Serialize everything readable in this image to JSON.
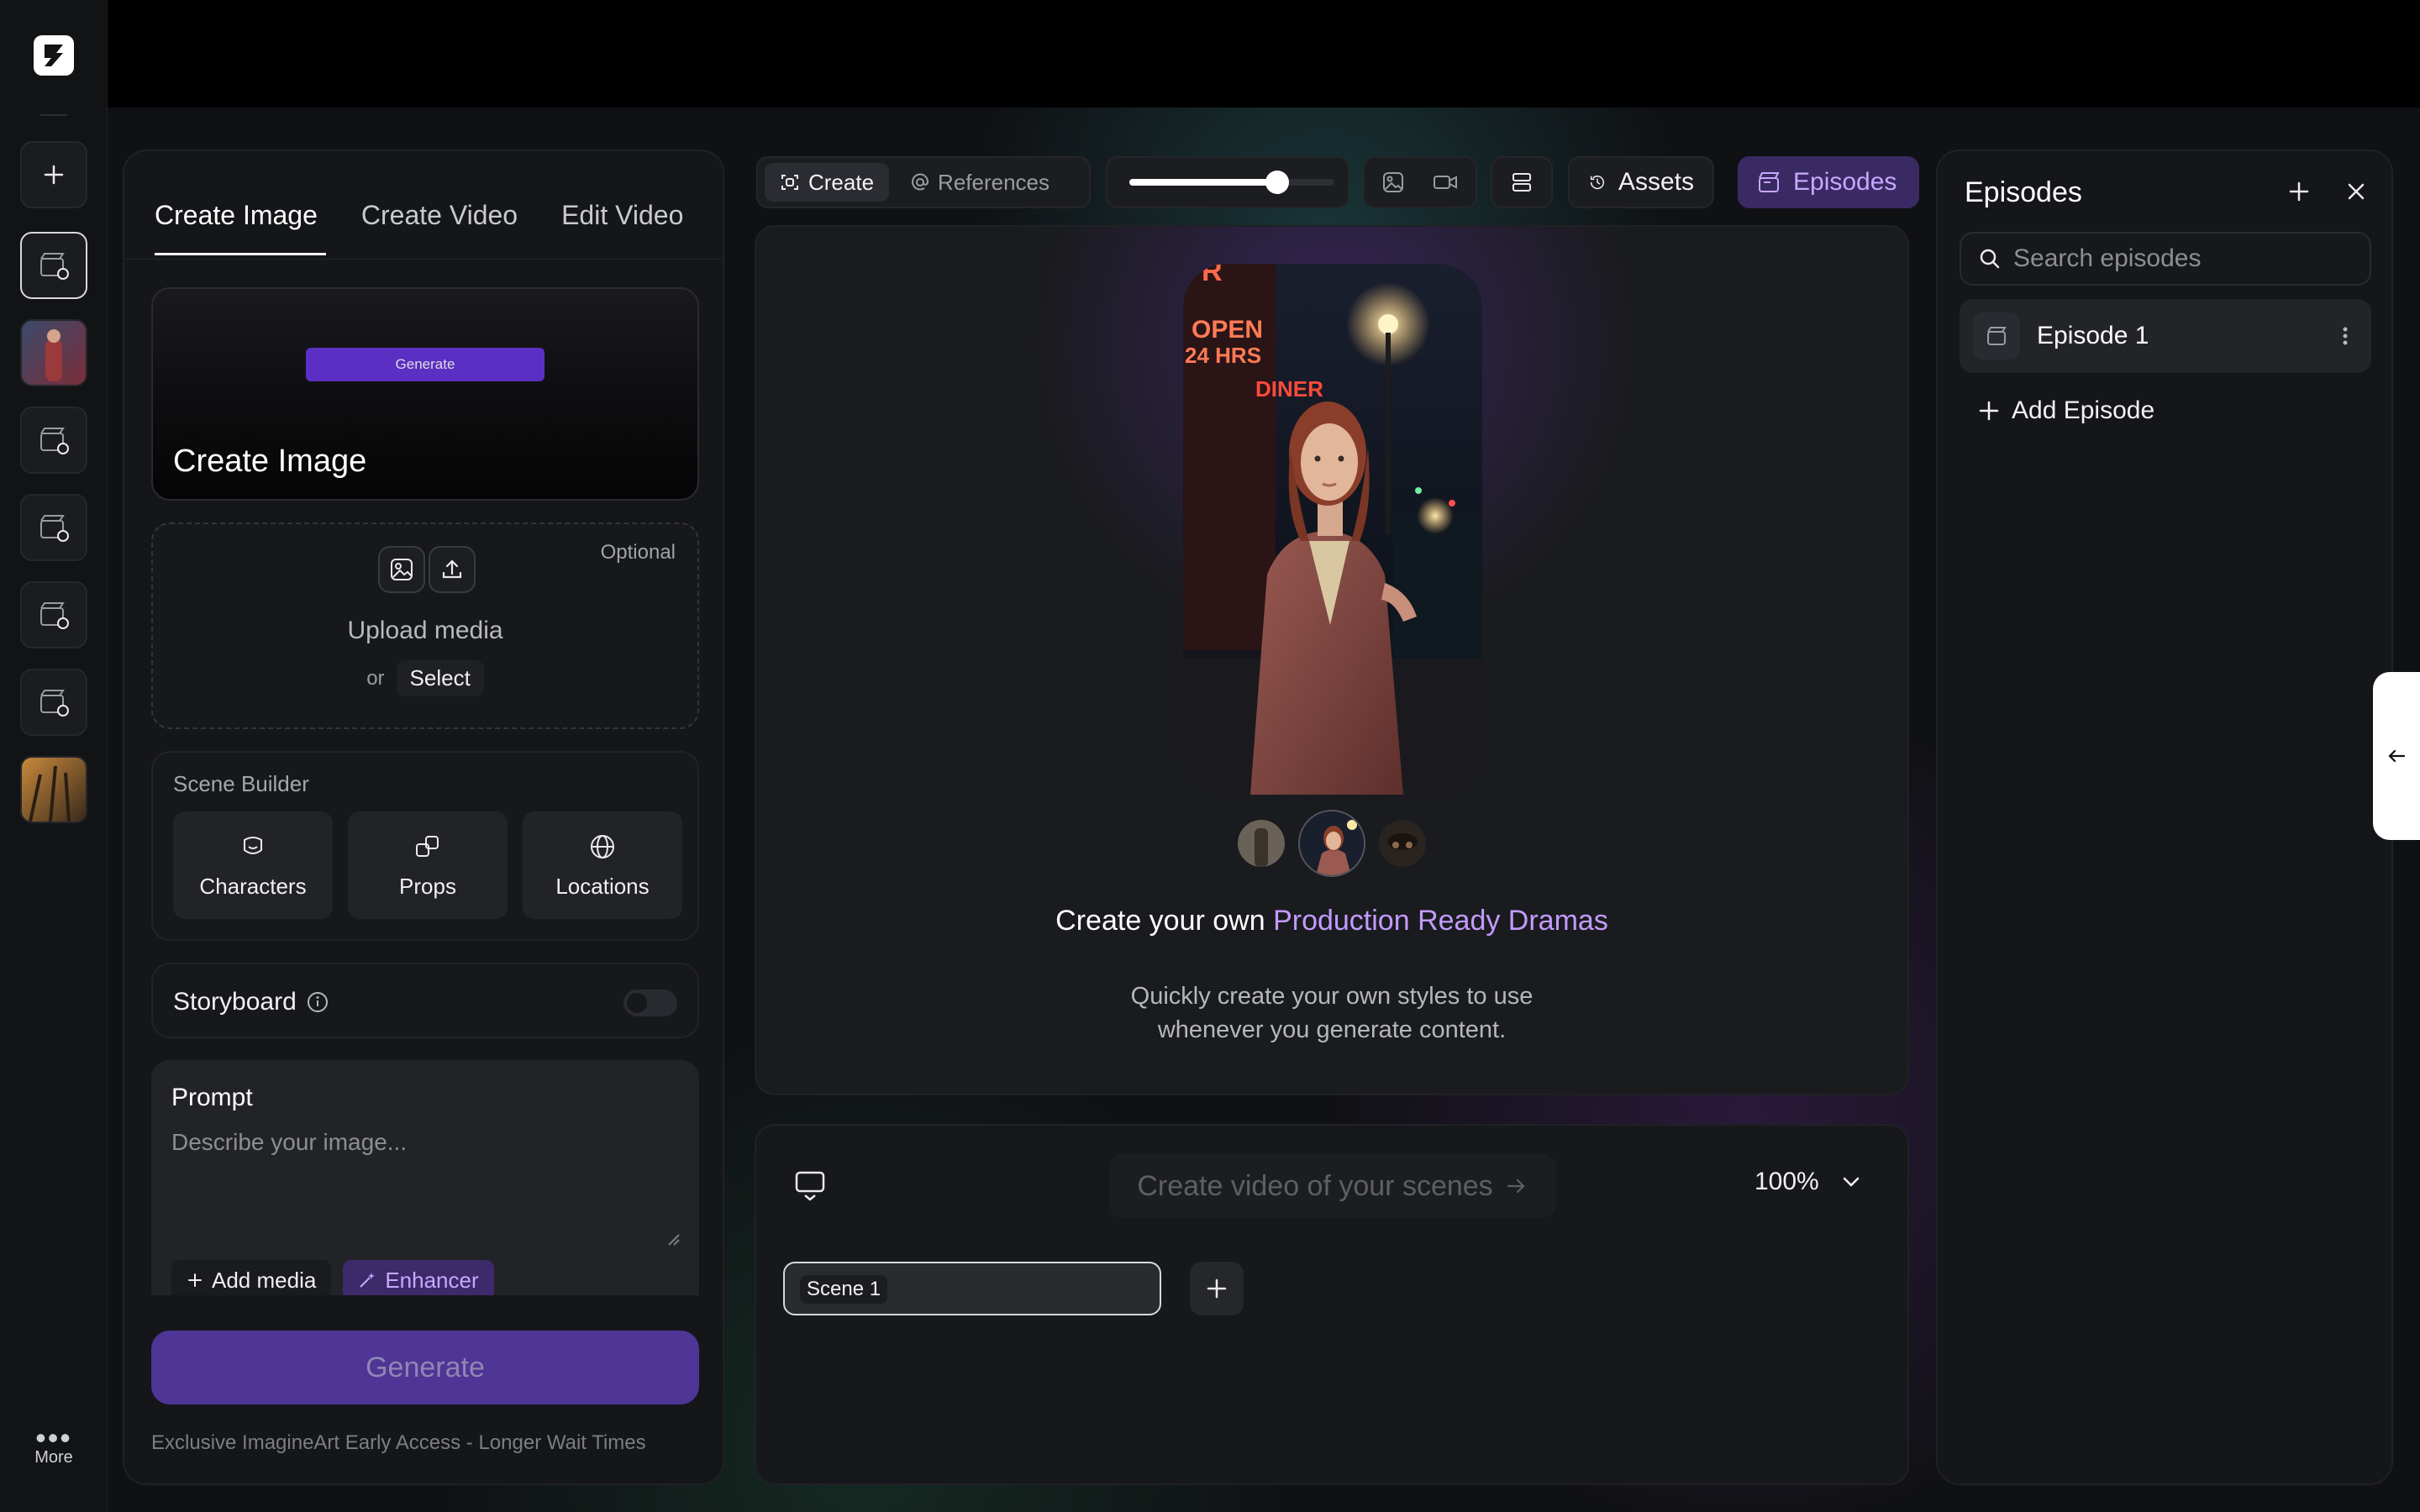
{
  "rail": {
    "items": [
      "new-project",
      "project-active",
      "project-photo",
      "project",
      "project",
      "project",
      "project",
      "project-photo"
    ],
    "more_label": "More"
  },
  "left_panel": {
    "tabs": [
      {
        "label": "Create Image",
        "active": true
      },
      {
        "label": "Create Video",
        "active": false
      },
      {
        "label": "Edit Video",
        "active": false
      }
    ],
    "hero": {
      "mini_button": "Generate",
      "title": "Create Image"
    },
    "upload": {
      "optional": "Optional",
      "title": "Upload media",
      "or": "or",
      "select": "Select"
    },
    "scene_builder": {
      "label": "Scene Builder",
      "cards": [
        {
          "label": "Characters",
          "icon": "character-icon"
        },
        {
          "label": "Props",
          "icon": "props-icon"
        },
        {
          "label": "Locations",
          "icon": "globe-icon"
        }
      ]
    },
    "storyboard": {
      "label": "Storyboard",
      "enabled": false
    },
    "prompt": {
      "label": "Prompt",
      "placeholder": "Describe your image...",
      "add_media": "Add media",
      "enhancer": "Enhancer"
    },
    "generate_label": "Generate",
    "footnote": "Exclusive ImagineArt Early Access - Longer Wait Times"
  },
  "toolbar": {
    "create": "Create",
    "references": "References",
    "slider_value": 0.72,
    "assets": "Assets",
    "episodes": "Episodes"
  },
  "preview": {
    "title_prefix": "Create your own ",
    "title_highlight": "Production Ready Dramas",
    "subtitle": "Quickly create your own styles to use whenever you generate content.",
    "sign_text_1": "OPEN",
    "sign_text_2": "24 HRS",
    "sign_text_3": "DINER",
    "sign_text_4": "R"
  },
  "timeline": {
    "cta": "Create video of your scenes",
    "zoom": "100%",
    "scenes": [
      {
        "label": "Scene 1"
      }
    ]
  },
  "episodes_panel": {
    "title": "Episodes",
    "search_placeholder": "Search episodes",
    "items": [
      {
        "label": "Episode 1"
      }
    ],
    "add_label": "Add Episode"
  },
  "colors": {
    "accent_purple": "#c39bff",
    "generate_bg": "#4e3596",
    "episodes_btn": "#3a2a63"
  }
}
